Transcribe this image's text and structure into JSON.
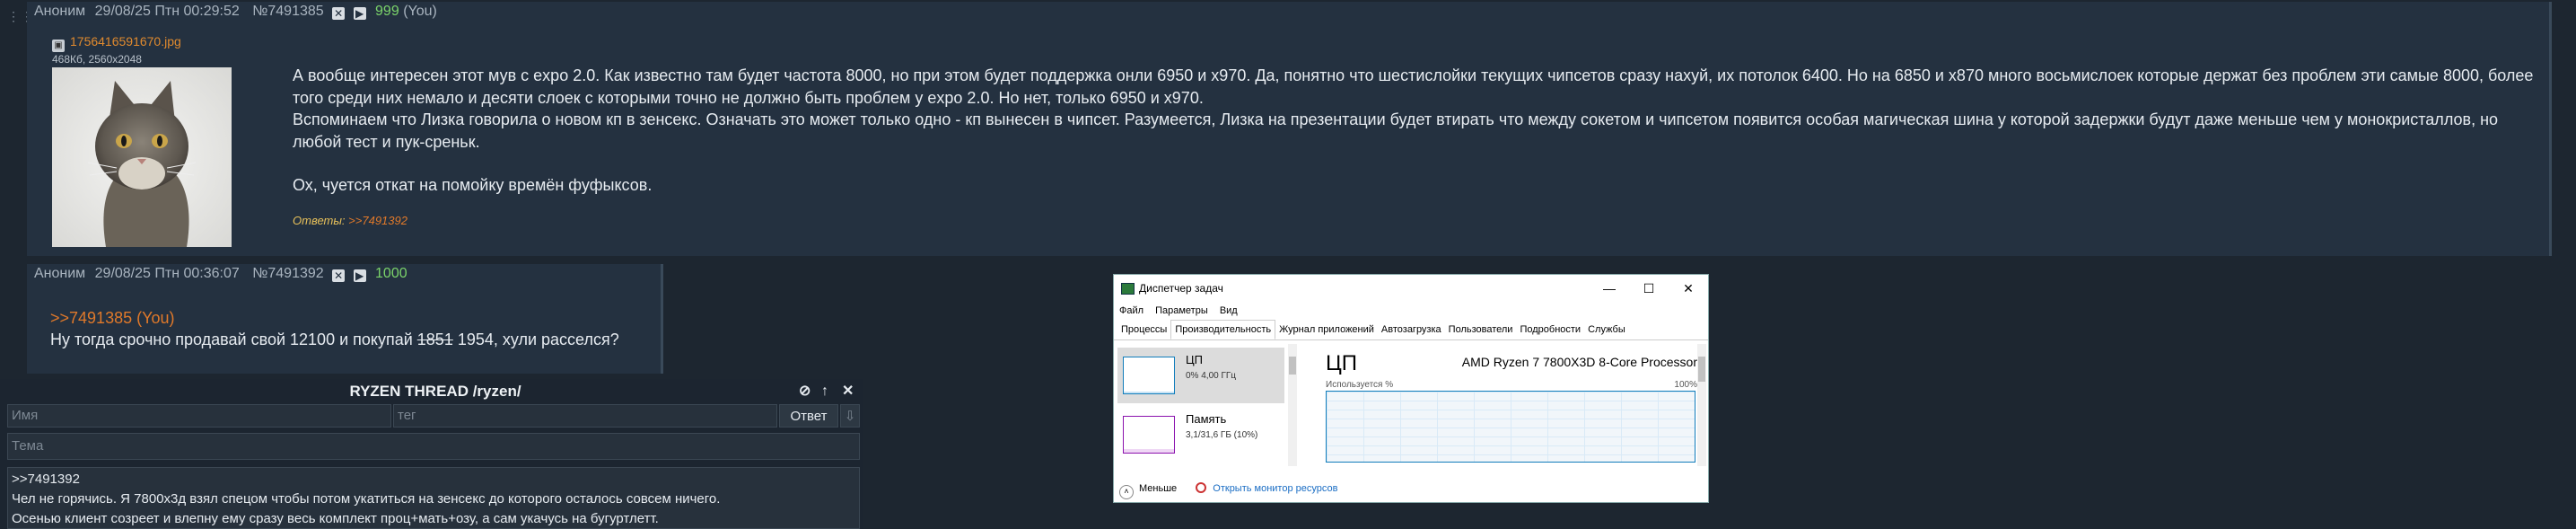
{
  "post1": {
    "author": "Аноним",
    "datetime": "29/08/25 Птн 00:29:52",
    "number": "№7491385",
    "reply_count": "999",
    "you_tag": "(You)",
    "file_name": "1756416591670.jpg",
    "file_info": "468Кб, 2560x2048",
    "paragraphs": [
      "А вообще интересен этот мув с expo 2.0. Как известно там будет частота 8000, но при этом будет поддержка онли 6950 и x970. Да, понятно что шестислойки текущих чипсетов сразу нахуй, их потолок 6400. Но на 6850 и x870 много восьмислоек которые держат без проблем эти самые 8000, более того среди них немало и десяти слоек с которыми точно не должно быть проблем у expo 2.0. Но нет, только 6950 и x970.",
      "Вспоминаем что Лизка говорила о новом кп в зенсекс. Означать это может только одно - кп вынесен в чипсет. Разумеется, Лизка на презентации будет втирать что между сокетом и чипсетом появится особая магическая шина у которой задержки будут даже меньше чем у монокристаллов, но любой тест и пук-среньк.",
      "",
      "Ох, чуется откат на помойку времён фуфыксов."
    ],
    "replies_label": "Ответы:",
    "replies_link": ">>7491392"
  },
  "post2": {
    "author": "Аноним",
    "datetime": "29/08/25 Птн 00:36:07",
    "number": "№7491392",
    "reply_count": "1000",
    "quote_link": ">>7491385 (You)",
    "text_before": "Ну тогда срочно продавай свой 12100 и покупай ",
    "text_strike": "1851",
    "text_after": " 1954, хули расселся?"
  },
  "form": {
    "title": "RYZEN THREAD /ryzen/",
    "name_placeholder": "Имя",
    "tag_placeholder": "тег",
    "reply_button": "Ответ",
    "subject_placeholder": "Тема",
    "message_lines": [
      ">>7491392",
      "Чел не горячись. Я 7800x3д взял спецом чтобы потом укатиться на зенсекс до которого осталось совсем ничего.",
      "Осенью клиент созреет и влепну ему сразу весь комплект проц+мать+озу, а сам укачусь на бугуртлетт."
    ]
  },
  "taskmgr": {
    "title": "Диспетчер задач",
    "menu": [
      "Файл",
      "Параметры",
      "Вид"
    ],
    "tabs": [
      "Процессы",
      "Производительность",
      "Журнал приложений",
      "Автозагрузка",
      "Пользователи",
      "Подробности",
      "Службы"
    ],
    "active_tab_index": 1,
    "side": [
      {
        "name": "ЦП",
        "sub": "0% 4,00 ГГц",
        "fill": 0.05
      },
      {
        "name": "Память",
        "sub": "3,1/31,6 ГБ (10%)",
        "fill": 0.1
      }
    ],
    "cpu_label": "ЦП",
    "cpu_model": "AMD Ryzen 7 7800X3D 8-Core Processor",
    "usage_label": "Используется %",
    "usage_max": "100%",
    "footer_less": "Меньше",
    "footer_monitor": "Открыть монитор ресурсов"
  },
  "colors": {
    "background": "#1d2630",
    "post_bg": "#243140",
    "link": "#e0792a",
    "reply_count": "#7bd36a"
  },
  "icons": [
    "close-icon",
    "play-icon",
    "image-file-icon",
    "settings-icon",
    "pin-icon",
    "minimize-icon",
    "maximize-icon",
    "less-details-icon",
    "resource-monitor-icon"
  ]
}
